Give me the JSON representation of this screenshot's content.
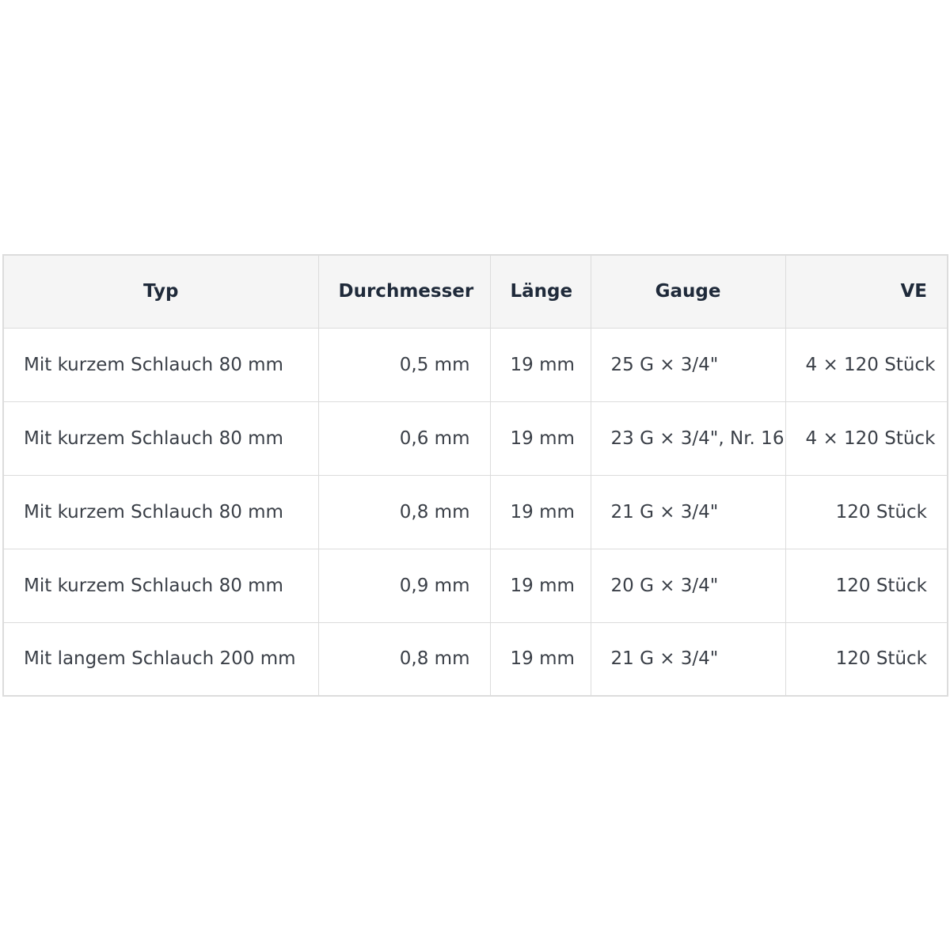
{
  "table": {
    "headers": {
      "typ": "Typ",
      "durchmesser": "Durchmesser",
      "laenge": "Länge",
      "gauge": "Gauge",
      "ve": "VE"
    },
    "rows": [
      {
        "typ": "Mit kurzem Schlauch 80 mm",
        "durchmesser": "0,5 mm",
        "laenge": "19 mm",
        "gauge": "25 G × 3/4\"",
        "ve": "4 × 120 Stück"
      },
      {
        "typ": "Mit kurzem Schlauch 80 mm",
        "durchmesser": "0,6 mm",
        "laenge": "19 mm",
        "gauge": "23 G × 3/4\", Nr. 16",
        "ve": "4 × 120 Stück"
      },
      {
        "typ": "Mit kurzem Schlauch 80 mm",
        "durchmesser": "0,8 mm",
        "laenge": "19 mm",
        "gauge": "21 G × 3/4\"",
        "ve": "120 Stück"
      },
      {
        "typ": "Mit kurzem Schlauch 80 mm",
        "durchmesser": "0,9 mm",
        "laenge": "19 mm",
        "gauge": "20 G × 3/4\"",
        "ve": "120 Stück"
      },
      {
        "typ": "Mit langem Schlauch 200 mm",
        "durchmesser": "0,8 mm",
        "laenge": "19 mm",
        "gauge": "21 G × 3/4\"",
        "ve": "120 Stück"
      }
    ]
  }
}
